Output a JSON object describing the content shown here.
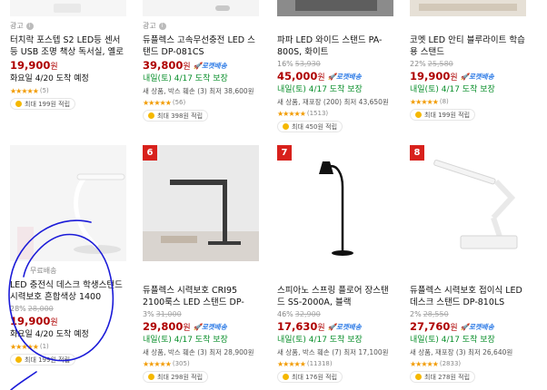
{
  "products": [
    {
      "ad_label": "광고",
      "title": "터치락 포스텝 S2 LED등 센서등 USB 조명 책상 독서실, 옐로우",
      "price": "19,900",
      "won": "원",
      "delivery": "화요일 4/20 도착 예정",
      "review_count": "(5)",
      "cash": "최대 199원 적립"
    },
    {
      "ad_label": "광고",
      "title": "듀플렉스 고속무선충전 LED 스탠드 DP-081CS",
      "price": "39,800",
      "won": "원",
      "rocket": "🚀로켓배송",
      "delivery": "내일(토) 4/17 도착 보장",
      "extra": "새 상품, 박스 훼손 (3) 최저 38,600원",
      "review_count": "(56)",
      "cash": "최대 398원 적립"
    },
    {
      "title": "파파 LED 와이드 스탠드 PA-800S, 화이트",
      "discount_pct": "16%",
      "orig_price": "53,930",
      "price": "45,000",
      "won": "원",
      "rocket": "🚀로켓배송",
      "delivery": "내일(토) 4/17 도착 보장",
      "extra": "새 상품, 재포장 (200) 최저 43,650원",
      "review_count": "(1513)",
      "cash": "최대 450원 적립"
    },
    {
      "title": "코멧 LED 안티 블루라이트 학습용 스탠드",
      "discount_pct": "22%",
      "orig_price": "25,580",
      "price": "19,900",
      "won": "원",
      "rocket": "🚀로켓배송",
      "delivery": "내일(토) 4/17 도착 보장",
      "review_count": "(8)",
      "cash": "최대 199원 적립"
    },
    {
      "free_shipping": "무료배송",
      "title": "LED 충전식 데스크 학생스탠드 시력보호 흔합색상 1400",
      "discount_pct": "28%",
      "orig_price": "28,000",
      "price": "19,900",
      "won": "원",
      "delivery": "화요일 4/20 도착 예정",
      "review_count": "(1)",
      "cash": "최대 199원 적립"
    },
    {
      "rank": "6",
      "title": "듀플렉스 시력보호 CRI95 2100룩스 LED 스탠드 DP-032LS",
      "discount_pct": "3%",
      "orig_price": "31,000",
      "price": "29,800",
      "won": "원",
      "rocket": "🚀로켓배송",
      "delivery": "내일(토) 4/17 도착 보장",
      "extra": "새 상품, 박스 훼손 (3) 최저 28,900원",
      "review_count": "(305)",
      "cash": "최대 298원 적립"
    },
    {
      "rank": "7",
      "title": "스피아노 스프링 플로어 장스탠드 SS-2000A, 블랙",
      "discount_pct": "46%",
      "orig_price": "32,900",
      "price": "17,630",
      "won": "원",
      "rocket": "🚀로켓배송",
      "delivery": "내일(토) 4/17 도착 보장",
      "extra": "새 상품, 박스 훼손 (7) 최저 17,100원",
      "review_count": "(11318)",
      "cash": "최대 176원 적립"
    },
    {
      "rank": "8",
      "title": "듀플렉스 시력보호 접이식 LED 데스크 스탠드 DP-810LS",
      "discount_pct": "2%",
      "orig_price": "28,550",
      "price": "27,760",
      "won": "원",
      "rocket": "🚀로켓배송",
      "delivery": "내일(토) 4/17 도착 보장",
      "extra": "새 상품, 재포장 (3) 최저 26,640원",
      "review_count": "(2833)",
      "cash": "최대 278원 적립"
    }
  ],
  "icons": {
    "star": "star-icon",
    "coin": "coin-icon",
    "info": "info-icon"
  },
  "colors": {
    "price": "#ae0000",
    "rocket": "#2f7ce6",
    "delivery_green": "#0a8f2c",
    "star": "#f29b00",
    "rank_badge": "#d8211c",
    "annotation_circle": "#1a1ad8"
  }
}
